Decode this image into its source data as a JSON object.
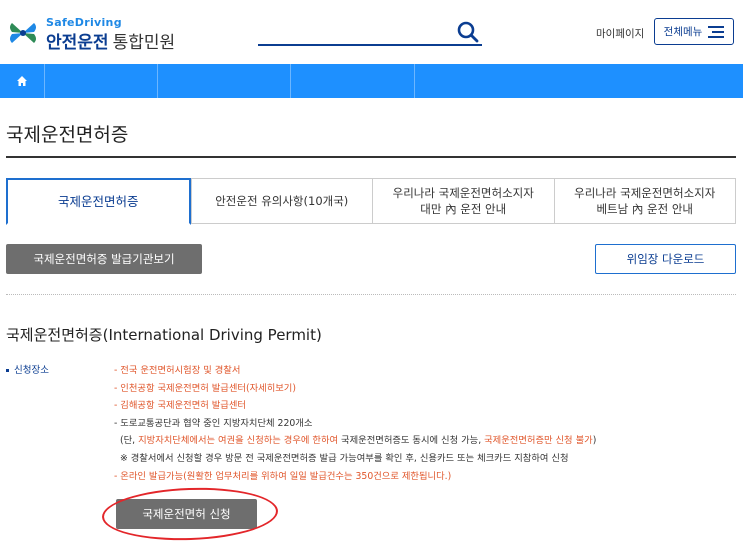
{
  "header": {
    "logo_en": "SafeDriving",
    "logo_ko": "안전운전",
    "logo_sub": "통합민원",
    "mypage_label": "마이페이지",
    "menu_label": "전체메뉴"
  },
  "page": {
    "title": "국제운전면허증"
  },
  "tabs": [
    {
      "line1": "국제운전면허증",
      "line2": "",
      "active": true
    },
    {
      "line1": "안전운전 유의사항(10개국)",
      "line2": ""
    },
    {
      "line1": "우리나라 국제운전면허소지자",
      "line2": "대만 內 운전 안내"
    },
    {
      "line1": "우리나라 국제운전면허소지자",
      "line2": "베트남 內 운전 안내"
    }
  ],
  "buttons": {
    "issuing_agencies": "국제운전면허증 발급기관보기",
    "power_of_attorney": "위임장 다운로드",
    "apply": "국제운전면허 신청"
  },
  "section": {
    "title": "국제운전면허증(International Driving Permit)",
    "place_label": "신청장소",
    "places": [
      "- 전국 운전면허시험장 및 경찰서",
      "- 인천공항 국제운전면허 발급센터(자세히보기)",
      "- 김해공항 국제운전면허 발급센터",
      "- 도로교통공단과 협약 중인 지방자치단체 220개소"
    ],
    "note1_a": "(단, ",
    "note1_b": "지방자치단체에서는 여권을 신청하는 경우에 한하여",
    "note1_c": " 국제운전면허증도 동시에 신청 가능, ",
    "note1_d": "국제운전면허증만 신청 불가",
    "note1_e": ")",
    "note2": "※ 경찰서에서 신청할 경우 방문 전 국제운전면허증 발급 가능여부를 확인 후, 신용카드 또는 체크카드 지참하여 신청",
    "online": "- 온라인 발급가능(원활한 업무처리를 위하여 일일 발급건수는 350건으로 제한됩니다.)"
  },
  "colors": {
    "nav_blue": "#1e90ff",
    "brand_navy": "#0b3d91",
    "accent_orange": "#e0562b",
    "highlight_red": "#e3262a"
  }
}
